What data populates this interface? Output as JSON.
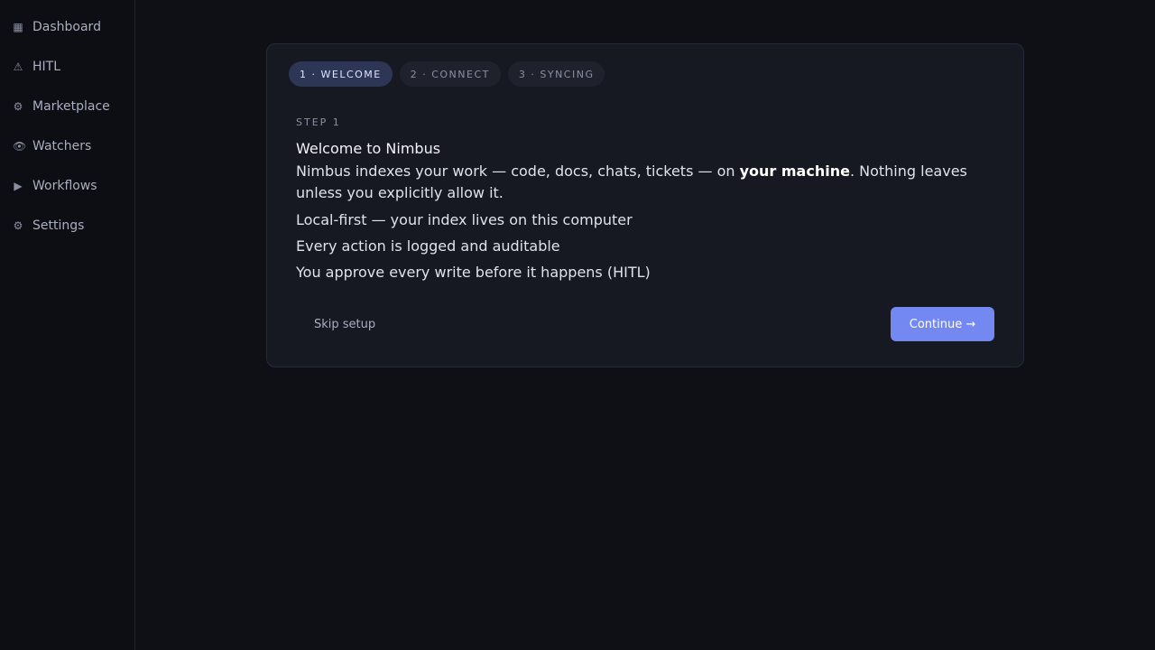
{
  "sidebar": {
    "items": [
      {
        "icon": "▦",
        "label": "Dashboard"
      },
      {
        "icon": "⚠",
        "label": "HITL"
      },
      {
        "icon": "⚙",
        "label": "Marketplace"
      },
      {
        "icon": "👁",
        "label": "Watchers"
      },
      {
        "icon": "▶",
        "label": "Workflows"
      },
      {
        "icon": "⚙",
        "label": "Settings"
      }
    ]
  },
  "onboarding": {
    "steps": [
      {
        "label": "1 · WELCOME",
        "active": true
      },
      {
        "label": "2 · CONNECT",
        "active": false
      },
      {
        "label": "3 · SYNCING",
        "active": false
      }
    ],
    "eyebrow": "STEP 1",
    "title": "Welcome to Nimbus",
    "description_before": "Nimbus indexes your work — code, docs, chats, tickets — on ",
    "description_bold": "your machine",
    "description_after": ". Nothing leaves unless you explicitly allow it.",
    "features": [
      "Local-first — your index lives on this computer",
      "Every action is logged and auditable",
      "You approve every write before it happens (HITL)"
    ],
    "skip_label": "Skip setup",
    "continue_label": "Continue →"
  },
  "colors": {
    "accent": "#7388f0",
    "background": "#0f1015",
    "card": "#171922",
    "active_step": "#2e3656"
  }
}
